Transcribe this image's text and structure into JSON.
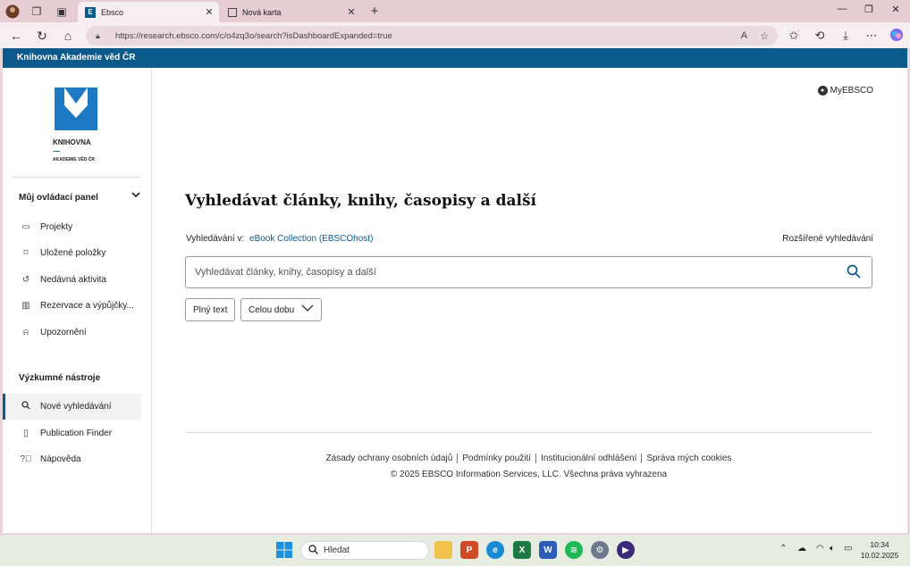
{
  "browser": {
    "tabs": [
      {
        "title": "Ebsco",
        "active": true
      },
      {
        "title": "Nová karta",
        "active": false
      }
    ],
    "url": "https://research.ebsco.com/c/o4zq3o/search?isDashboardExpanded=true"
  },
  "page": {
    "institution": "Knihovna Akademie věd ČR",
    "logo": {
      "line1": "KNIHOVNA",
      "line2": "AKADEMIE VĚD ČR"
    },
    "dashboard": {
      "title": "Můj ovládací panel",
      "items": [
        {
          "label": "Projekty",
          "icon": "projects-icon"
        },
        {
          "label": "Uložené položky",
          "icon": "bookmark-icon"
        },
        {
          "label": "Nedávná aktivita",
          "icon": "history-icon"
        },
        {
          "label": "Rezervace a výpůjčky...",
          "icon": "books-icon"
        },
        {
          "label": "Upozornění",
          "icon": "bell-icon"
        }
      ]
    },
    "tools": {
      "title": "Výzkumné nástroje",
      "items": [
        {
          "label": "Nové vyhledávání",
          "icon": "search-icon",
          "active": true
        },
        {
          "label": "Publication Finder",
          "icon": "document-icon",
          "active": false
        },
        {
          "label": "Nápověda",
          "icon": "help-icon",
          "active": false
        }
      ]
    },
    "myebsco": "MyEBSCO",
    "headline": "Vyhledávat články, knihy, časopisy a další",
    "scope_label": "Vyhledávání v:",
    "scope_collection": "eBook Collection (EBSCOhost)",
    "advanced": "Rozšířené vyhledávání",
    "search_placeholder": "Vyhledávat články, knihy, časopisy a další",
    "filters": {
      "fulltext": "Plný text",
      "date": "Celou dobu"
    },
    "footer": {
      "links": [
        "Zásady ochrany osobních údajů",
        "Podmínky použití",
        "Institucionální odhlášení",
        "Správa mých cookies"
      ],
      "copyright": "© 2025 EBSCO Information Services, LLC. Všechna práva vyhrazena"
    }
  },
  "taskbar": {
    "search": "Hledat",
    "time": "10:34",
    "date": "10.02.2025"
  },
  "colors": {
    "brand": "#0c5a8c"
  }
}
